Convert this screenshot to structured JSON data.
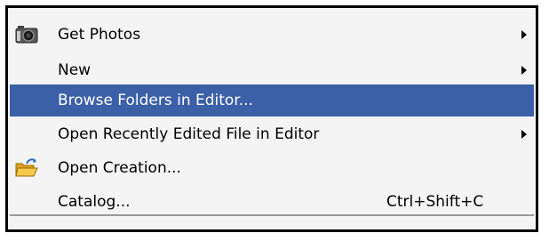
{
  "menu": {
    "items": [
      {
        "label": "Get Photos",
        "icon": "camera-icon",
        "submenu": true
      },
      {
        "label": "New",
        "submenu": true
      },
      {
        "label": "Browse Folders in Editor...",
        "highlighted": true
      },
      {
        "label": "Open Recently Edited File in Editor",
        "submenu": true
      },
      {
        "label": "Open Creation...",
        "icon": "folder-open-icon"
      },
      {
        "label": "Catalog...",
        "shortcut": "Ctrl+Shift+C"
      }
    ]
  },
  "colors": {
    "highlight": "#3b60a8",
    "menu_background": "#f4f4f4",
    "border": "#000000"
  }
}
